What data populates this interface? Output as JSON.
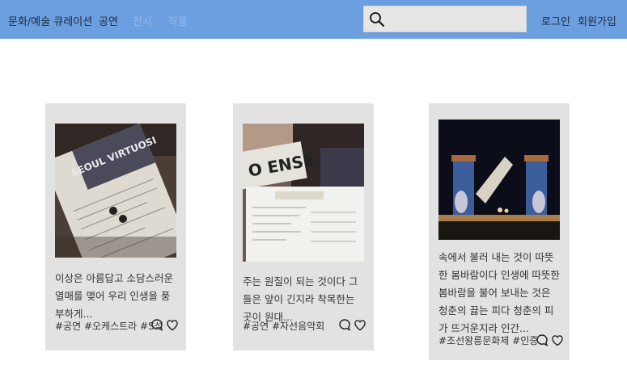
{
  "brand": "문화/예술 큐레이션",
  "nav": [
    "공연",
    "전시",
    "작품"
  ],
  "search": {
    "placeholder": "",
    "icon": "search-icon"
  },
  "auth": {
    "login": "로그인",
    "signup": "회원가입"
  },
  "colors": {
    "navbar": "#6b9fe0",
    "card": "#e2e2e2",
    "search_box": "#e6e6e6",
    "inactive_nav": "#9db9e6"
  },
  "cards": [
    {
      "text": "이상은 아름답고 소담스러운 열매를 맺어 우리 인생을 풍부하게...",
      "tags": "#공연 #오케스트라 #S석",
      "image_text": "SEOUL VIRTUOSI"
    },
    {
      "text": "주는 원질이 되는 것이다 그들은 앞이 긴지라 착목한는 곳이 원대...",
      "tags": "#공연 #자선음악회",
      "image_text": "O ENSE"
    },
    {
      "text": "속에서 불러 내는 것이 따뜻한 봄바람이다 인생에 따뜻한 봄바람을 불어 보내는 것은 청춘의 끓는 피다 청춘의 피가 뜨거운지라 인간...",
      "tags": "#조선왕릉문화제 #인증"
    }
  ]
}
